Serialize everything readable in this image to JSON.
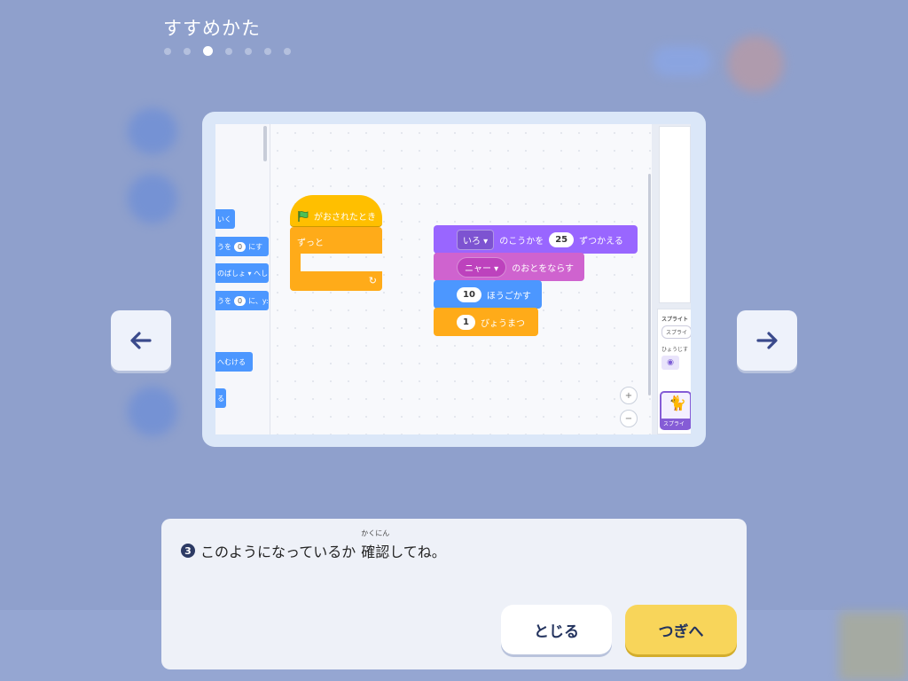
{
  "header": {
    "title": "すすめかた",
    "steps_total": 7,
    "step_current": 3
  },
  "navigation": {
    "prev_icon": "arrow-left-icon",
    "next_icon": "arrow-right-icon"
  },
  "preview": {
    "palette_blocks": [
      {
        "text": "いく"
      },
      {
        "pre": "うを",
        "val": "0",
        "post": "にす"
      },
      {
        "text": "のばしょ ▾ へし"
      },
      {
        "pre": "うを",
        "val": "0",
        "post": "に、y:"
      },
      {
        "text": "へむける"
      },
      {
        "text": "る"
      }
    ],
    "hat_label": "がおされたとき",
    "forever_label": "ずっと",
    "script_blocks": [
      {
        "dropdown": "いろ ▾",
        "mid": "のこうかを",
        "value": "25",
        "post": "ずつかえる",
        "color": "#9966ff"
      },
      {
        "dropdown": "ニャー ▾",
        "mid": "のおとをならす",
        "color": "#cf63cf"
      },
      {
        "value": "10",
        "post": "ほうごかす",
        "color": "#4c97ff"
      },
      {
        "value": "1",
        "post": "びょうまつ",
        "color": "#ffab19"
      }
    ],
    "sprite_panel": {
      "label_sprite": "スプライト",
      "field_sprite": "スプライ",
      "label_show": "ひょうじす",
      "thumb_label": "スプライ"
    },
    "zoom_in_icon": "zoom-in-icon",
    "zoom_out_icon": "zoom-out-icon"
  },
  "dialog": {
    "step_badge": "3",
    "message_pre": "このようになっているか",
    "message_kanji": "確認",
    "message_ruby": "かくにん",
    "message_post": "してね。",
    "close_label": "とじる",
    "next_label": "つぎへ"
  },
  "colors": {
    "overlay": "#8b9ec9",
    "next_button": "#f8d55a",
    "text_dark": "#23335e"
  }
}
